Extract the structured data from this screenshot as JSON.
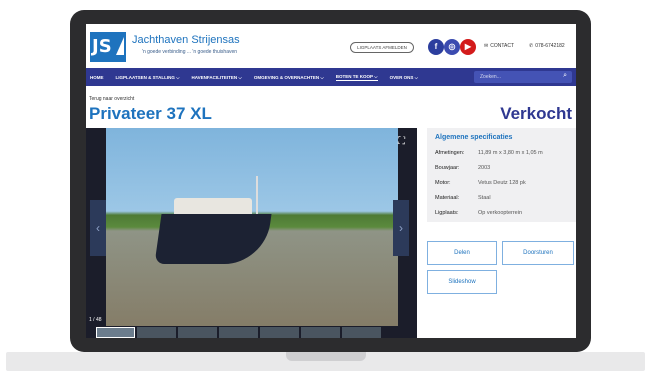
{
  "header": {
    "logo_text": "JS",
    "brand": "Jachthaven Strijensas",
    "tagline": "'n goede verbinding ... 'n goede thuishaven",
    "ligplaats_btn": "LIGPLAATS AFMELDEN",
    "contact": "CONTACT",
    "phone": "078-6742182"
  },
  "nav": {
    "items": [
      "HOME",
      "LIGPLAATSEN & STALLING ⌵",
      "HAVENFACILITEITEN ⌵",
      "OMGEVING & OVERNACHTEN ⌵",
      "BOTEN TE KOOP ⌵",
      "OVER ONS ⌵"
    ],
    "search_placeholder": "Zoeken..."
  },
  "page": {
    "back": "Terug naar overzicht",
    "title": "Privateer 37 XL",
    "status": "Verkocht",
    "counter": "1 / 48"
  },
  "specs": {
    "heading": "Algemene specificaties",
    "rows": [
      {
        "label": "Afmetingen:",
        "value": "11,89 m x 3,80 m x 1,05 m"
      },
      {
        "label": "Bouwjaar:",
        "value": "2003"
      },
      {
        "label": "Motor:",
        "value": "Vetus Deutz 128 pk"
      },
      {
        "label": "Materiaal:",
        "value": "Staal"
      },
      {
        "label": "Ligplaats:",
        "value": "Op verkoopterrein"
      }
    ]
  },
  "actions": {
    "share": "Delen",
    "forward": "Doorsturen",
    "slideshow": "Slideshow"
  },
  "colors": {
    "primary": "#1e73be",
    "nav": "#2f3891",
    "youtube": "#d31b1b"
  }
}
